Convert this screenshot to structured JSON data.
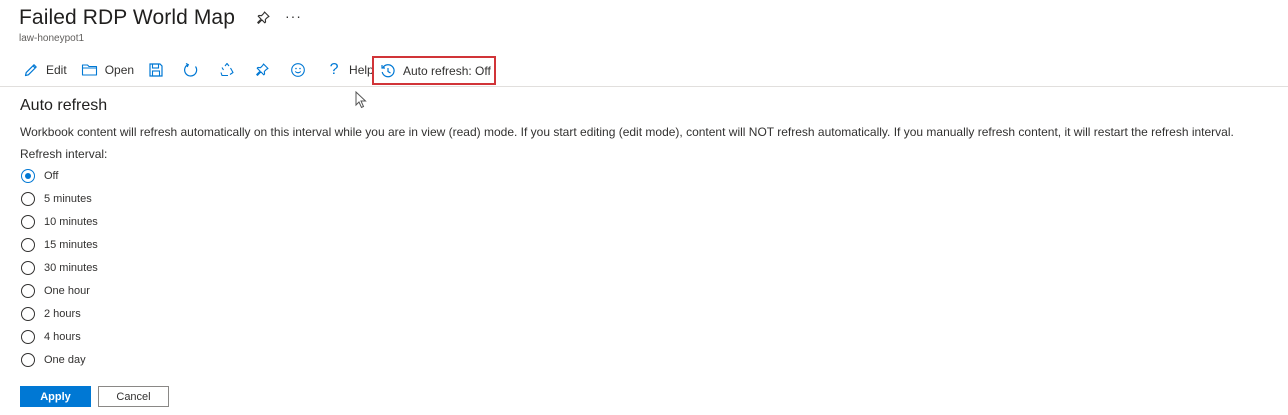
{
  "header": {
    "title": "Failed RDP World Map",
    "subtitle": "law-honeypot1",
    "more_label": "···"
  },
  "toolbar": {
    "edit_label": "Edit",
    "open_label": "Open",
    "help_label": "Help",
    "auto_refresh_label": "Auto refresh: Off",
    "icons": [
      "edit-icon",
      "folder-open-icon",
      "save-icon",
      "refresh-icon",
      "recycle-icon",
      "pin-icon",
      "smiley-feedback-icon",
      "help-icon",
      "clock-history-icon"
    ]
  },
  "panel": {
    "title": "Auto refresh",
    "description": "Workbook content will refresh automatically on this interval while you are in view (read) mode. If you start editing (edit mode), content will NOT refresh automatically. If you manually refresh content, it will restart the refresh interval.",
    "interval_label": "Refresh interval:",
    "options": [
      {
        "label": "Off",
        "checked": true
      },
      {
        "label": "5 minutes",
        "checked": false
      },
      {
        "label": "10 minutes",
        "checked": false
      },
      {
        "label": "15 minutes",
        "checked": false
      },
      {
        "label": "30 minutes",
        "checked": false
      },
      {
        "label": "One hour",
        "checked": false
      },
      {
        "label": "2 hours",
        "checked": false
      },
      {
        "label": "4 hours",
        "checked": false
      },
      {
        "label": "One day",
        "checked": false
      }
    ],
    "apply_label": "Apply",
    "cancel_label": "Cancel"
  },
  "colors": {
    "accent": "#0078d4",
    "highlight_border": "#d13438",
    "text": "#323130"
  }
}
